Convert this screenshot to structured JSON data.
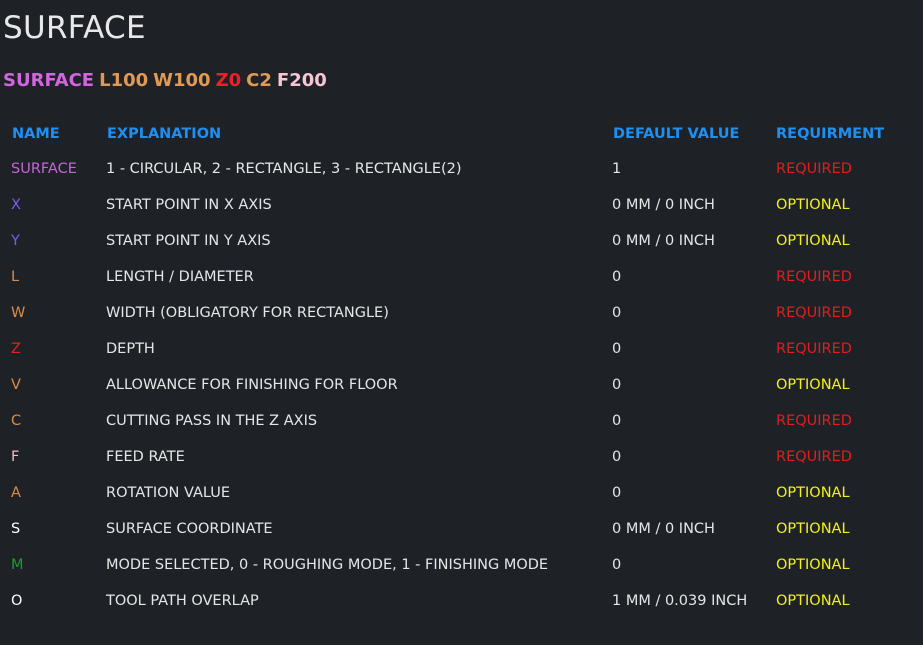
{
  "title": "SURFACE",
  "command": [
    {
      "text": "SURFACE",
      "color": "#d266e0"
    },
    {
      "text": "L100",
      "color": "#e09a55"
    },
    {
      "text": "W100",
      "color": "#e09a55"
    },
    {
      "text": "Z0",
      "color": "#e8222a"
    },
    {
      "text": "C2",
      "color": "#e09a55"
    },
    {
      "text": "F200",
      "color": "#f7c6d2"
    }
  ],
  "headers": {
    "name": "NAME",
    "explanation": "EXPLANATION",
    "default_value": "DEFAULT VALUE",
    "requirment": "REQUIRMENT",
    "color": "#1f8ff2"
  },
  "status_colors": {
    "REQUIRED": "#e01e1e",
    "OPTIONAL": "#f2f21a"
  },
  "rows": [
    {
      "name": "SURFACE",
      "name_color": "#c466d6",
      "explanation": "1 - CIRCULAR, 2 - RECTANGLE, 3 - RECTANGLE(2)",
      "default": "1",
      "requirment": "REQUIRED"
    },
    {
      "name": "X",
      "name_color": "#7b5cf0",
      "explanation": "START POINT IN X AXIS",
      "default": "0 MM / 0 INCH",
      "requirment": "OPTIONAL"
    },
    {
      "name": "Y",
      "name_color": "#7b5cf0",
      "explanation": "START POINT IN Y AXIS",
      "default": "0 MM / 0 INCH",
      "requirment": "OPTIONAL"
    },
    {
      "name": "L",
      "name_color": "#d98c4a",
      "explanation": "LENGTH / DIAMETER",
      "default": "0",
      "requirment": "REQUIRED"
    },
    {
      "name": "W",
      "name_color": "#d98c4a",
      "explanation": "WIDTH (OBLIGATORY FOR RECTANGLE)",
      "default": "0",
      "requirment": "REQUIRED"
    },
    {
      "name": "Z",
      "name_color": "#e02222",
      "explanation": "DEPTH",
      "default": "0",
      "requirment": "REQUIRED"
    },
    {
      "name": "V",
      "name_color": "#d98c4a",
      "explanation": "ALLOWANCE FOR FINISHING FOR FLOOR",
      "default": "0",
      "requirment": "OPTIONAL"
    },
    {
      "name": "C",
      "name_color": "#d98c4a",
      "explanation": "CUTTING PASS IN THE Z AXIS",
      "default": "0",
      "requirment": "REQUIRED"
    },
    {
      "name": "F",
      "name_color": "#f2b8c8",
      "explanation": "FEED RATE",
      "default": "0",
      "requirment": "REQUIRED"
    },
    {
      "name": "A",
      "name_color": "#d98c4a",
      "explanation": "ROTATION VALUE",
      "default": "0",
      "requirment": "OPTIONAL"
    },
    {
      "name": "S",
      "name_color": "#ffffff",
      "explanation": "SURFACE COORDINATE",
      "default": "0 MM / 0 INCH",
      "requirment": "OPTIONAL"
    },
    {
      "name": "M",
      "name_color": "#1f9e2a",
      "explanation": "MODE SELECTED, 0 - ROUGHING MODE, 1 - FINISHING MODE",
      "default": "0",
      "requirment": "OPTIONAL"
    },
    {
      "name": "O",
      "name_color": "#ffffff",
      "explanation": "TOOL PATH OVERLAP",
      "default": "1 MM / 0.039 INCH",
      "requirment": "OPTIONAL"
    }
  ],
  "text_color": "#e6e6e6"
}
